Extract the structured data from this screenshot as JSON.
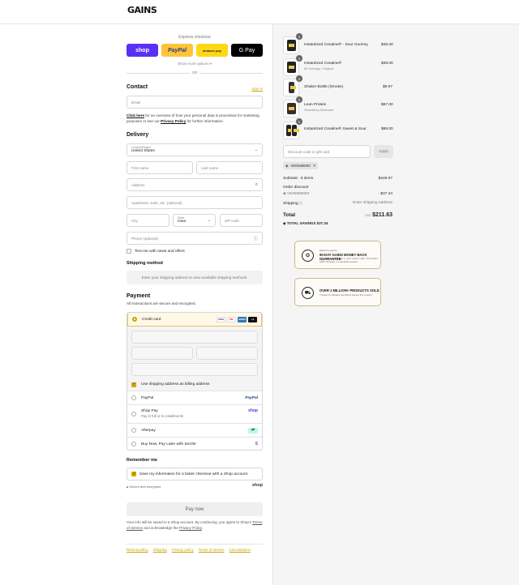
{
  "header": {
    "logo": "GAINS"
  },
  "express": {
    "label": "Express checkout",
    "shop": "shop",
    "paypal": "PayPal",
    "amazon": "amazon pay",
    "gpay": "G Pay",
    "show_more": "Show more options ▾",
    "or": "OR"
  },
  "contact": {
    "title": "Contact",
    "sign_in": "Sign in",
    "email_placeholder": "Email",
    "privacy_pre": "for an overview of how your personal data is processed for marketing purposes or see our",
    "click_here": "Click here",
    "privacy_policy": "Privacy Policy",
    "privacy_post": "for further information."
  },
  "delivery": {
    "title": "Delivery",
    "country_label": "Country/Region",
    "country_value": "United States",
    "first_name": "First name",
    "last_name": "Last name",
    "address": "Address",
    "apartment": "Apartment, suite, etc. (optional)",
    "city": "City",
    "state_label": "State",
    "state_value": "Iowa",
    "zip": "ZIP code",
    "phone": "Phone (optional)",
    "news": "Text me with news and offers"
  },
  "shipping_method": {
    "title": "Shipping method",
    "placeholder": "Enter your shipping address to view available shipping methods."
  },
  "payment": {
    "title": "Payment",
    "subtitle": "All transactions are secure and encrypted.",
    "credit_card": "Credit card",
    "brands": [
      "VISA",
      "MC",
      "AMEX",
      "+4"
    ],
    "billing_same": "Use shipping address as billing address",
    "paypal": "PayPal",
    "paypal_logo": "PayPal",
    "shop_pay": "Shop Pay",
    "shop_pay_sub": "Pay in full or in installments",
    "shop_pay_logo": "shop",
    "afterpay": "Afterpay",
    "afterpay_logo": "⇄",
    "sezzle": "Buy Now, Pay Later with Sezzle",
    "sezzle_logo": "S"
  },
  "remember": {
    "title": "Remember me",
    "save_info": "Save my information for a faster checkout with a Shop account",
    "secure": "Secure and encrypted",
    "shop_logo": "shop"
  },
  "pay_now": "Pay now",
  "legal": {
    "pre": "Your info will be saved to a Shop account. By continuing, you agree to Shop's",
    "terms": "Terms of Service",
    "mid": "and acknowledge the",
    "privacy": "Privacy Policy",
    "post": "."
  },
  "footer_links": [
    "Refund policy",
    "Shipping",
    "Privacy policy",
    "Terms of service",
    "Cancellations"
  ],
  "cart": {
    "items": [
      {
        "name": "Instantized Creatine® - Sour Gummy",
        "variant": "",
        "price": "$45.00",
        "qty": "1"
      },
      {
        "name": "Instantized Creatine®",
        "variant": "80 Servings / Original",
        "price": "$39.00",
        "qty": "1"
      },
      {
        "name": "Shaker Bottle (Smoke)",
        "variant": "",
        "price": "$9.97",
        "qty": "1"
      },
      {
        "name": "Lean Protein",
        "variant": "Strawberry Shortcake",
        "price": "$67.00",
        "qty": "1"
      },
      {
        "name": "Instantized Creatine® Sweet & Sour",
        "variant": "",
        "price": "$89.00",
        "qty": "1"
      }
    ],
    "discount_placeholder": "Discount code or gift card",
    "apply": "Apply",
    "code": "VEIN598093",
    "subtotal_label": "Subtotal · 5 items",
    "subtotal_value": "$248.97",
    "order_discount_label": "Order discount",
    "discount_code": "VEIN598093",
    "discount_value": "- $37.34",
    "shipping_label": "Shipping",
    "shipping_value": "Enter shipping address",
    "total_label": "Total",
    "currency": "USD",
    "total_value": "$211.63",
    "savings_label": "TOTAL SAVINGS",
    "savings_value": "$37.34"
  },
  "promos": [
    {
      "title": "90-DAY GAINS MONEY BACK GUARANTEE",
      "sub": "Try it. If you don't love it, we'll make it right. Full refund within 90 days, no questions asked.",
      "pre": "Backed by science",
      "icon": "✪"
    },
    {
      "title": "OVER 1 MILLION+ PRODUCTS SOLD",
      "sub": "Trusted by athletes and lifters across the country.",
      "pre": "",
      "icon": "⛟"
    }
  ]
}
